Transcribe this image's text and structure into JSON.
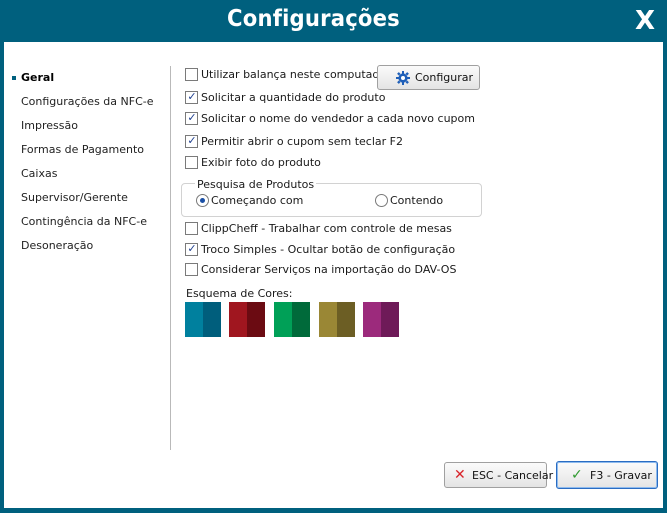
{
  "window": {
    "title": "Configurações",
    "close_label": "X"
  },
  "sidebar": {
    "items": [
      {
        "label": "Geral",
        "active": true
      },
      {
        "label": "Configurações da NFC-e"
      },
      {
        "label": "Impressão"
      },
      {
        "label": "Formas de Pagamento"
      },
      {
        "label": "Caixas"
      },
      {
        "label": "Supervisor/Gerente"
      },
      {
        "label": "Contingência da NFC-e"
      },
      {
        "label": "Desoneração"
      }
    ]
  },
  "options": {
    "balanca": {
      "label": "Utilizar balança neste computador",
      "checked": false
    },
    "configurar_button": "Configurar",
    "quantidade": {
      "label": "Solicitar a quantidade do produto",
      "checked": true
    },
    "vendedor": {
      "label": "Solicitar o nome do vendedor a cada novo cupom",
      "checked": true
    },
    "abrir_cupom": {
      "label": "Permitir abrir o cupom sem teclar F2",
      "checked": true
    },
    "foto": {
      "label": "Exibir foto do produto",
      "checked": false
    }
  },
  "pesquisa": {
    "title": "Pesquisa de Produtos",
    "comecando": {
      "label": "Começando com",
      "selected": true
    },
    "contendo": {
      "label": "Contendo",
      "selected": false
    }
  },
  "extras": {
    "clippcheff": {
      "label": "ClippCheff - Trabalhar com controle de mesas",
      "checked": false
    },
    "troco": {
      "label": "Troco Simples - Ocultar botão de configuração",
      "checked": true
    },
    "servicos": {
      "label": "Considerar Serviços na importação do DAV-OS",
      "checked": false
    }
  },
  "color_schemes": {
    "title": "Esquema de Cores:",
    "swatches": [
      {
        "left": "#00809e",
        "right": "#005e7c"
      },
      {
        "left": "#a0161f",
        "right": "#6b0b12"
      },
      {
        "left": "#00a057",
        "right": "#006a3a"
      },
      {
        "left": "#9a8735",
        "right": "#6c5e24"
      },
      {
        "left": "#9c2a7c",
        "right": "#6e1a58"
      }
    ]
  },
  "footer": {
    "cancel_label": "ESC - Cancelar",
    "save_label": "F3 - Gravar"
  },
  "colors": {
    "accent": "#00607e"
  }
}
